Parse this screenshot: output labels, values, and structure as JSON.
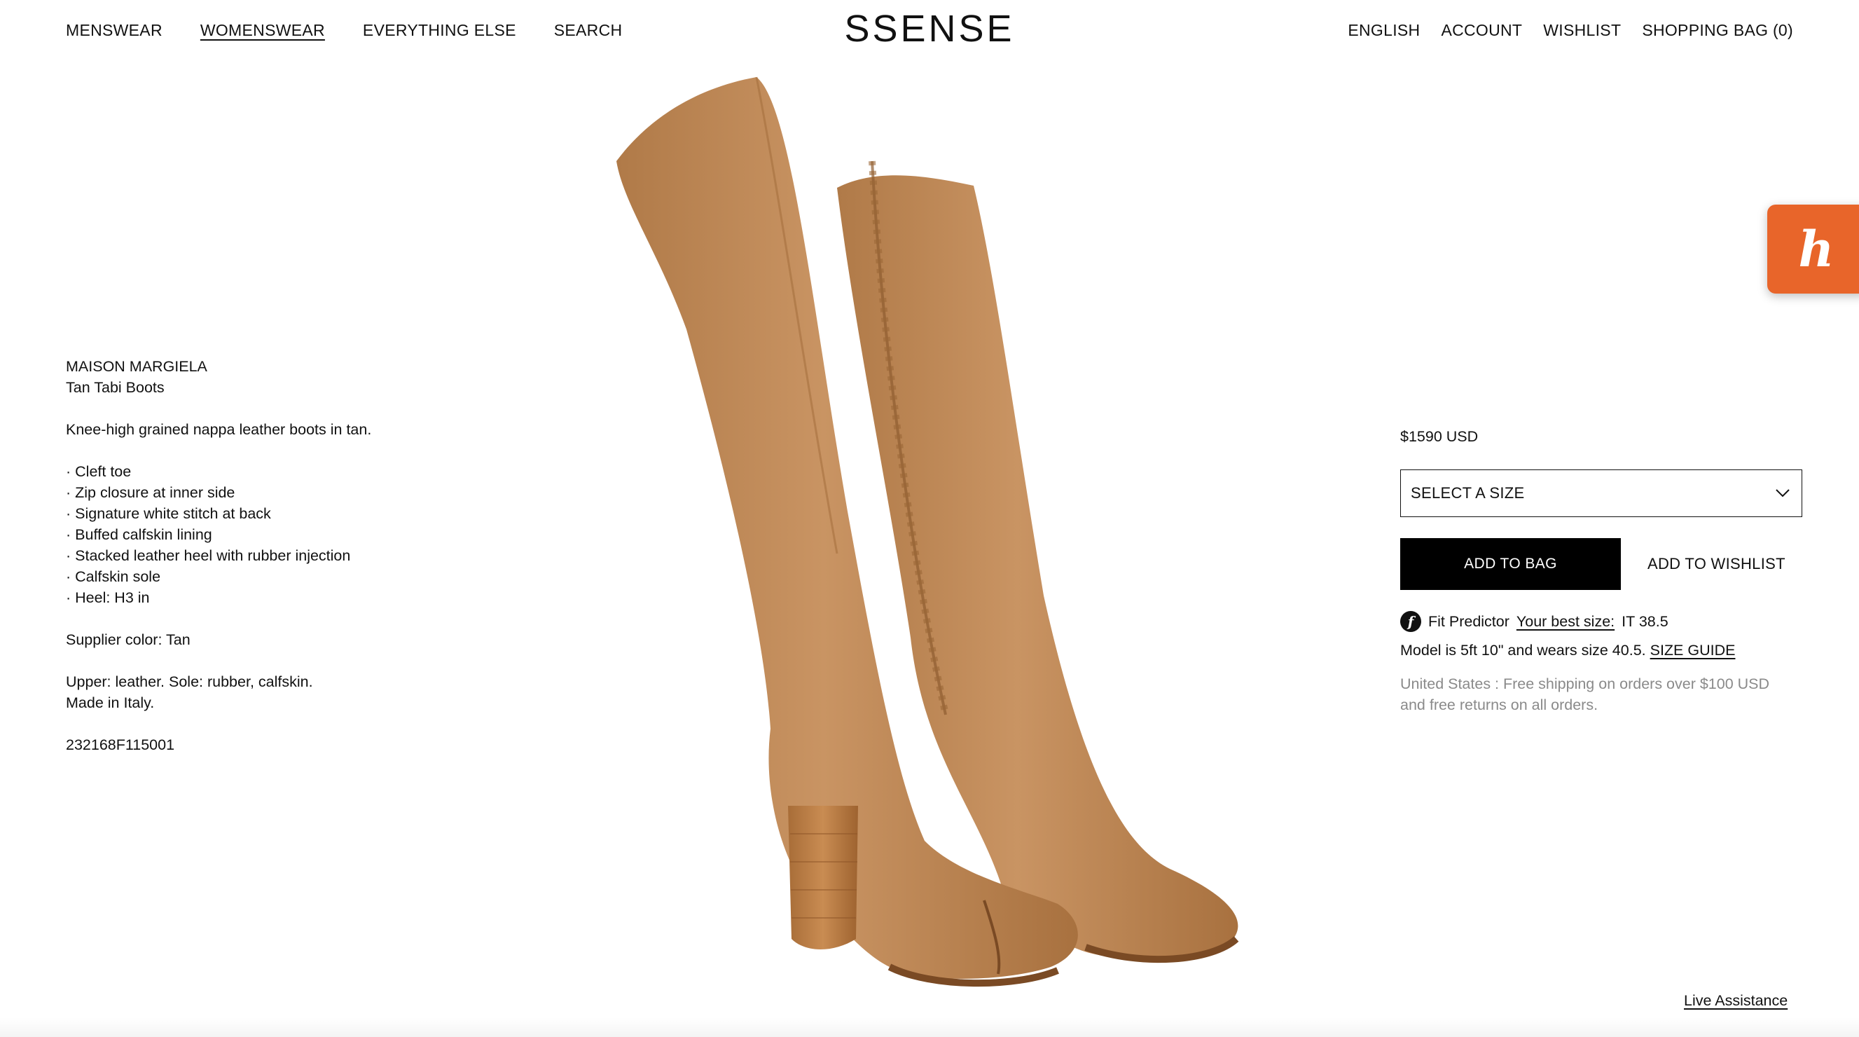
{
  "header": {
    "nav_left": [
      "MENSWEAR",
      "WOMENSWEAR",
      "EVERYTHING ELSE",
      "SEARCH"
    ],
    "logo": "SSENSE",
    "nav_right": [
      "ENGLISH",
      "ACCOUNT",
      "WISHLIST",
      "SHOPPING BAG (0)"
    ]
  },
  "product": {
    "brand": "MAISON MARGIELA",
    "name": "Tan Tabi Boots",
    "summary": "Knee-high grained nappa leather boots in tan.",
    "features": [
      "Cleft toe",
      "Zip closure at inner side",
      "Signature white stitch at back",
      "Buffed calfskin lining",
      "Stacked leather heel with rubber injection",
      "Calfskin sole",
      "Heel: H3 in"
    ],
    "supplier_color": "Supplier color: Tan",
    "materials": "Upper: leather. Sole: rubber, calfskin.",
    "origin": "Made in Italy.",
    "sku": "232168F115001",
    "image_icon": "tan-knee-high-boots-image",
    "leather_color": "#c18a58"
  },
  "purchase": {
    "price": "$1590 USD",
    "size_select_label": "SELECT A SIZE",
    "add_to_bag": "ADD TO BAG",
    "add_to_wishlist": "ADD TO WISHLIST",
    "fit_predictor_label": "Fit Predictor",
    "best_size_link": "Your best size:",
    "best_size_value": "IT 38.5",
    "model_info": "Model is 5ft 10\" and wears size 40.5.",
    "size_guide": "SIZE GUIDE",
    "shipping_note": "United States : Free shipping on orders over $100 USD and free returns on all orders."
  },
  "widgets": {
    "honey_glyph": "h",
    "honey_color": "#e8652a",
    "live_assistance": "Live Assistance"
  }
}
